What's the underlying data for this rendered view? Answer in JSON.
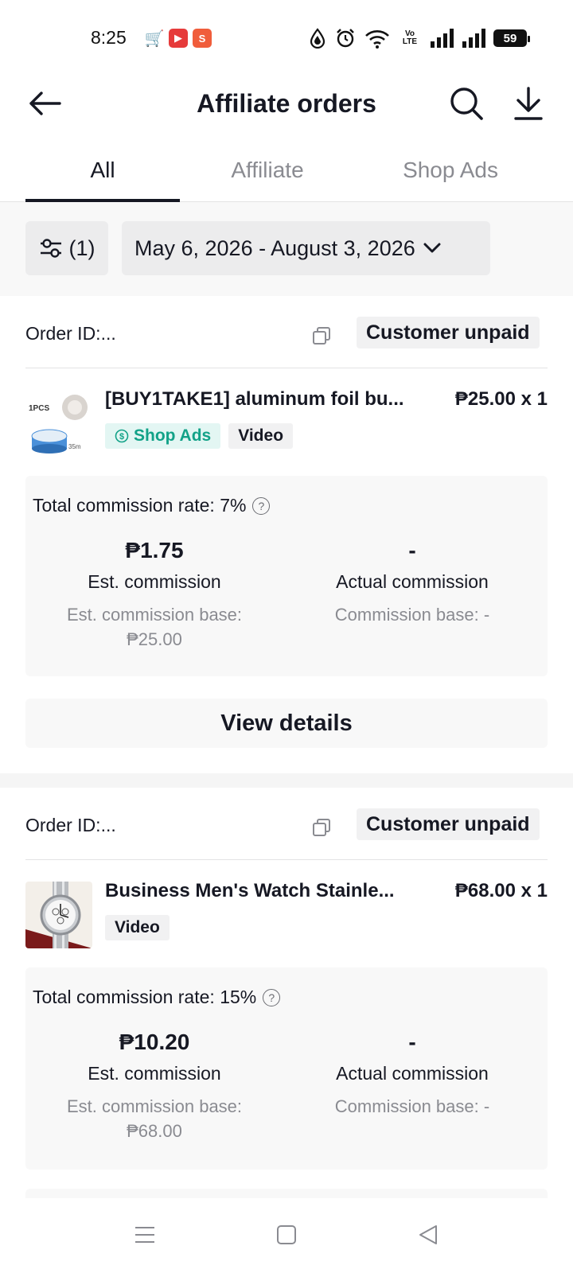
{
  "status_bar": {
    "time": "8:25",
    "battery": "59",
    "network_label": "Vo LTE"
  },
  "header": {
    "title": "Affiliate orders"
  },
  "tabs": [
    {
      "label": "All",
      "active": true
    },
    {
      "label": "Affiliate",
      "active": false
    },
    {
      "label": "Shop Ads",
      "active": false
    }
  ],
  "filter": {
    "count_label": "(1)",
    "date_range": "May 6, 2026 - August 3, 2026"
  },
  "orders": [
    {
      "order_id_label": "Order ID:...",
      "status": "Customer unpaid",
      "product_name": "[BUY1TAKE1] aluminum foil bu...",
      "price_qty": "₱25.00 x 1",
      "tags": [
        "Shop Ads",
        "Video"
      ],
      "commission_rate": "Total commission rate: 7%",
      "est_commission_value": "₱1.75",
      "est_commission_label": "Est. commission",
      "est_base_label": "Est. commission base:",
      "est_base_value": "₱25.00",
      "actual_commission_value": "-",
      "actual_commission_label": "Actual commission",
      "actual_base": "Commission base: -",
      "view_details": "View details"
    },
    {
      "order_id_label": "Order ID:...",
      "status": "Customer unpaid",
      "product_name": "Business Men's Watch Stainle...",
      "price_qty": "₱68.00 x 1",
      "tags": [
        "Video"
      ],
      "commission_rate": "Total commission rate: 15%",
      "est_commission_value": "₱10.20",
      "est_commission_label": "Est. commission",
      "est_base_label": "Est. commission base:",
      "est_base_value": "₱68.00",
      "actual_commission_value": "-",
      "actual_commission_label": "Actual commission",
      "actual_base": "Commission base: -"
    }
  ],
  "colors": {
    "accent_text": "#161823",
    "muted_text": "#8a8b91",
    "shop_ads_tag_bg": "#e3f6f3",
    "shop_ads_tag_text": "#12a288",
    "panel_bg": "#f8f8f8"
  }
}
